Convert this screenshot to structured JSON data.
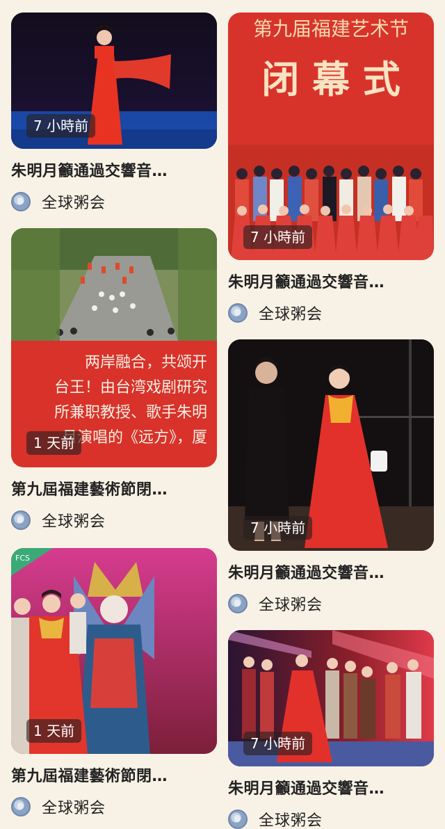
{
  "feed": {
    "cards": [
      {
        "time": "7 小時前",
        "title": "朱明月籲通過交響音…",
        "source": "全球粥会"
      },
      {
        "time": "7 小時前",
        "title": "朱明月籲通過交響音…",
        "source": "全球粥会",
        "image_text": {
          "line1": "第九届福建艺术节",
          "line2": "闭 幕 式"
        }
      },
      {
        "time": "1 天前",
        "title": "第九屆福建藝術節閉…",
        "source": "全球粥会",
        "image_text": {
          "line1": "两岸融合，共颂开",
          "line2": "台王！由台湾戏剧研究",
          "line3": "所兼职教授、歌手朱明",
          "line4": "月演唱的《远方》，厦"
        }
      },
      {
        "time": "7 小時前",
        "title": "朱明月籲通過交響音…",
        "source": "全球粥会"
      },
      {
        "time": "1 天前",
        "title": "第九屆福建藝術節閉…",
        "source": "全球粥会",
        "image_text": {
          "logo": "FCS"
        }
      },
      {
        "time": "7 小時前",
        "title": "朱明月籲通過交響音…",
        "source": "全球粥会"
      }
    ]
  }
}
